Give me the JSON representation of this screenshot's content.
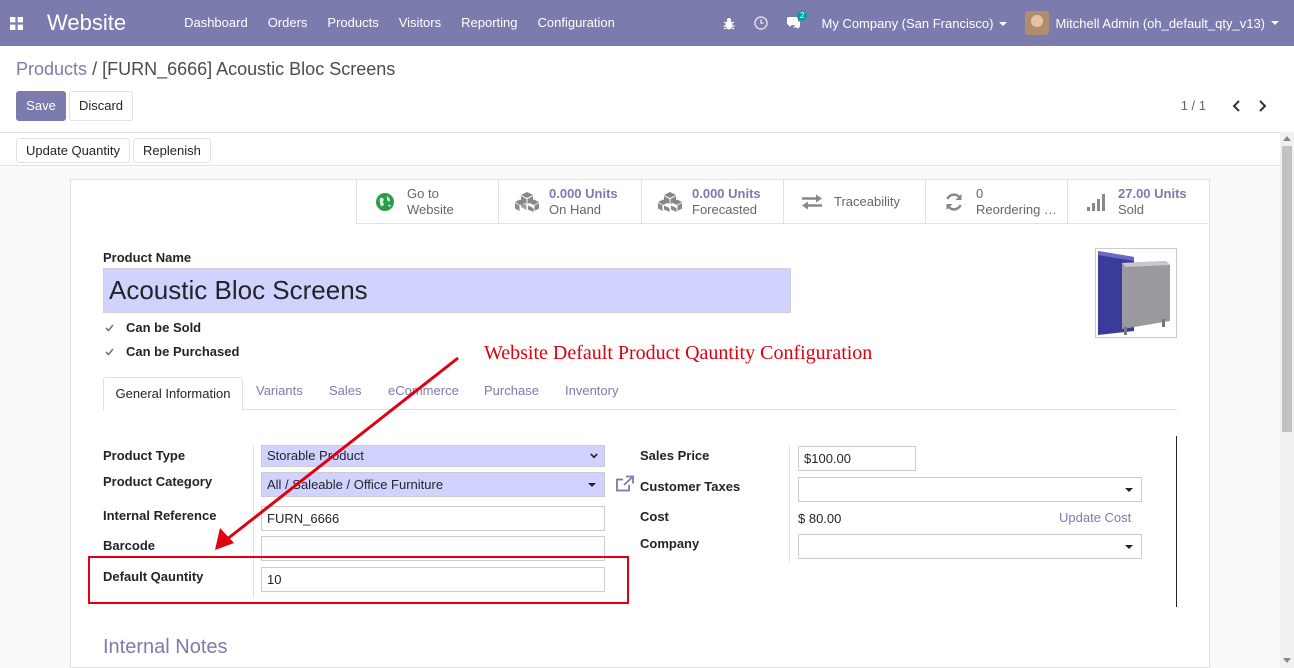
{
  "navbar": {
    "app_name": "Website",
    "menu": [
      "Dashboard",
      "Orders",
      "Products",
      "Visitors",
      "Reporting",
      "Configuration"
    ],
    "chat_badge": "2",
    "company": "My Company (San Francisco)",
    "user": "Mitchell Admin (oh_default_qty_v13)",
    "bg_color": "#7c7bad"
  },
  "breadcrumb": {
    "parent": "Products",
    "separator": "/",
    "current": "[FURN_6666] Acoustic Bloc Screens"
  },
  "buttons": {
    "save": "Save",
    "discard": "Discard",
    "update_quantity": "Update Quantity",
    "replenish": "Replenish"
  },
  "pager": {
    "value": "1 / 1"
  },
  "stats": [
    {
      "value": "Go to",
      "label": "Website",
      "icon": "globe-icon"
    },
    {
      "value": "0.000 Units",
      "label": "On Hand",
      "icon": "cubes-icon"
    },
    {
      "value": "0.000 Units",
      "label": "Forecasted",
      "icon": "cubes-icon"
    },
    {
      "value": "",
      "label": "Traceability",
      "icon": "exchange-icon"
    },
    {
      "value": "0",
      "label": "Reordering …",
      "icon": "refresh-icon"
    },
    {
      "value": "27.00 Units",
      "label": "Sold",
      "icon": "signal-icon"
    }
  ],
  "product": {
    "name_label": "Product Name",
    "name": "Acoustic Bloc Screens",
    "can_be_sold": "Can be Sold",
    "can_be_purchased": "Can be Purchased"
  },
  "tabs": [
    "General Information",
    "Variants",
    "Sales",
    "eCommerce",
    "Purchase",
    "Inventory"
  ],
  "left_fields": {
    "product_type_label": "Product Type",
    "product_type": "Storable Product",
    "product_category_label": "Product Category",
    "product_category": "All / Saleable / Office Furniture",
    "internal_reference_label": "Internal Reference",
    "internal_reference": "FURN_6666",
    "barcode_label": "Barcode",
    "barcode": "",
    "default_quantity_label": "Default Qauntity",
    "default_quantity": "10"
  },
  "right_fields": {
    "sales_price_label": "Sales Price",
    "sales_price": "$100.00",
    "customer_taxes_label": "Customer Taxes",
    "cost_label": "Cost",
    "cost": "$ 80.00",
    "update_cost": "Update Cost",
    "company_label": "Company"
  },
  "internal_notes": "Internal Notes",
  "annotation": {
    "text": "Website Default Product Qauntity Configuration",
    "color": "#e0000f"
  }
}
